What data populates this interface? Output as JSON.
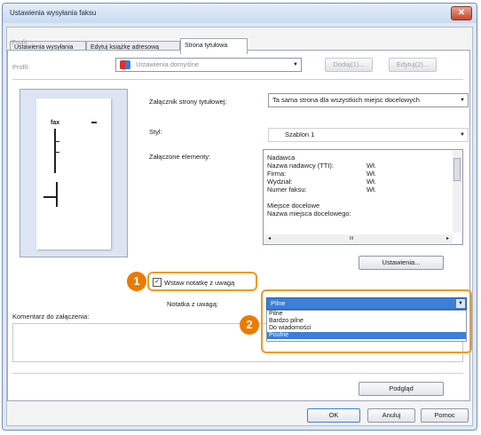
{
  "window": {
    "title": "Ustawienia wysyłania faksu",
    "close_glyph": "✕"
  },
  "tabs": [
    {
      "label": "Ustawienia wysyłania"
    },
    {
      "label": "Edytuj książkę adresową"
    },
    {
      "label": "Strona tytułowa"
    }
  ],
  "profile": {
    "label": "Profil:",
    "value": "Ustawienia domyślne",
    "add_button": "Dodaj(1)...",
    "edit_button": "Edytuj(2)..."
  },
  "preview": {
    "fax_text": "fax",
    "icon": "cover-page-preview-icon"
  },
  "attachment": {
    "label": "Załącznik strony tytułowej:",
    "value": "Ta sama strona dla wszystkich miejsc docelowych"
  },
  "style": {
    "label": "Styl:",
    "value": "Szablon 1"
  },
  "included": {
    "label": "Załączone elementy:",
    "items": [
      {
        "name": "Nadawca",
        "value": ""
      },
      {
        "name": "Nazwa nadawcy (TTI):",
        "value": "Wł."
      },
      {
        "name": "Firma:",
        "value": "Wł."
      },
      {
        "name": "Wydział:",
        "value": "Wł."
      },
      {
        "name": "Numer faksu:",
        "value": "Wł."
      },
      {
        "name": "",
        "value": ""
      },
      {
        "name": "Miejsce docelowe",
        "value": ""
      },
      {
        "name": "Nazwa miejsca docelowego:",
        "value": ""
      }
    ],
    "scroll_left": "◂",
    "scroll_right": "▸",
    "scroll_mid": "III"
  },
  "settings_button": "Ustawienia...",
  "note_checkbox": {
    "label": "Wstaw notatkę z uwagą",
    "checked": true,
    "check_glyph": "✓"
  },
  "note_select": {
    "label": "Notatka z uwagą:",
    "value": "Pilne",
    "options": [
      "Pilne",
      "Bardzo pilne",
      "Do wiadomości",
      "Poufne"
    ],
    "highlighted_option": "Poufne"
  },
  "comment": {
    "label": "Komentarz do załączenia:"
  },
  "preview_button": "Podgląd",
  "footer": {
    "ok": "OK",
    "cancel": "Anuluj",
    "help": "Pomoc"
  },
  "callouts": {
    "one": "1",
    "two": "2"
  },
  "colors": {
    "callout": "#ec7a00",
    "highlight": "#ef9a20",
    "selection": "#3b7fd6"
  }
}
